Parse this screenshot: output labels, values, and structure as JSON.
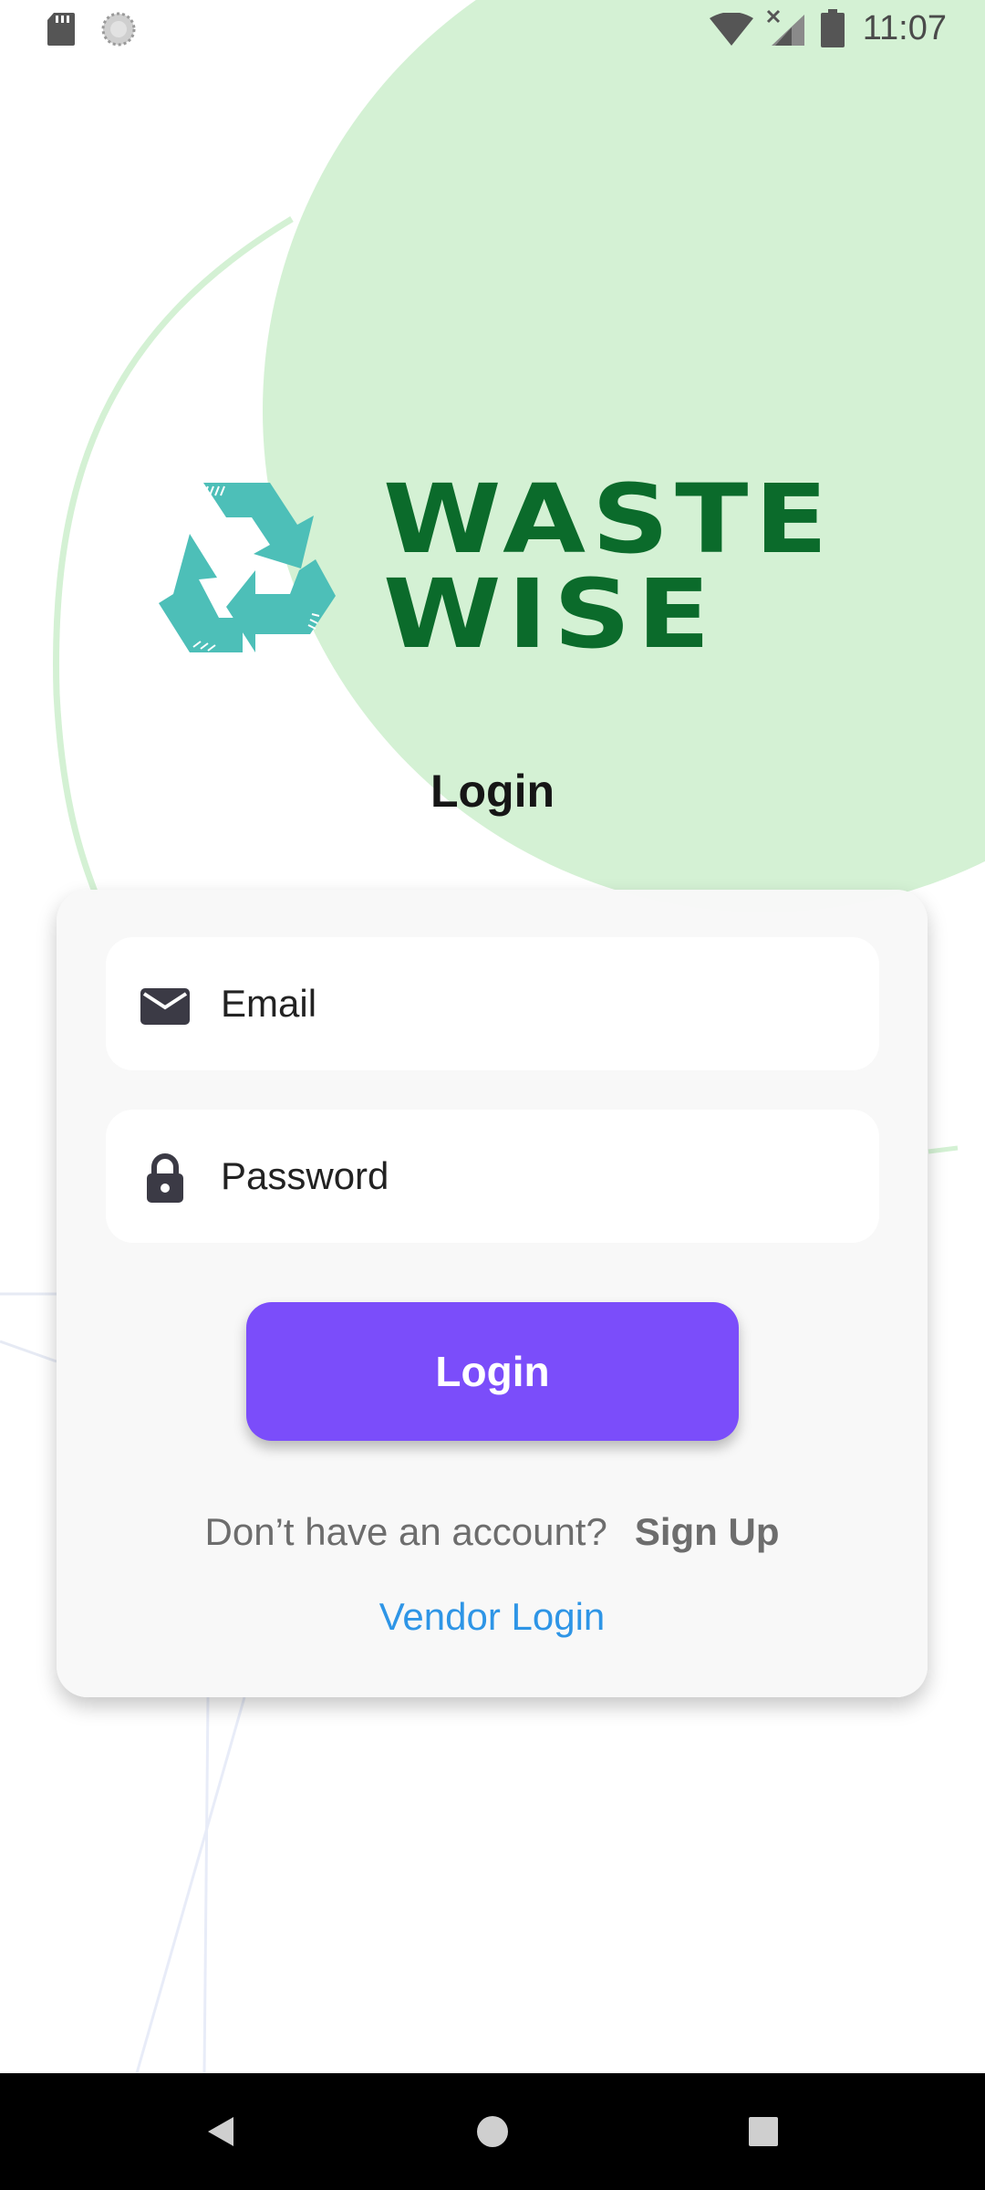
{
  "status_bar": {
    "time": "11:07",
    "left_icons": [
      "sd-card-icon",
      "sync-icon"
    ],
    "right_icons": [
      "wifi-icon",
      "signal-icon",
      "battery-icon"
    ]
  },
  "logo": {
    "line1": "WASTE",
    "line2": "WISE",
    "icon": "recycle-icon",
    "icon_color": "#4dbfb8",
    "text_color": "#0b6b2b"
  },
  "page_title": "Login",
  "form": {
    "email_placeholder": "Email",
    "email_icon": "mail-icon",
    "password_placeholder": "Password",
    "password_icon": "lock-icon",
    "login_button": "Login",
    "no_account_text": "Don’t have an account?",
    "signup_link": "Sign Up",
    "vendor_link": "Vendor Login"
  },
  "colors": {
    "accent": "#7b4dfa",
    "link": "#2e95e6",
    "background_circle": "#d4f1d4"
  },
  "nav_bar": {
    "buttons": [
      "back-icon",
      "home-icon",
      "recents-icon"
    ]
  }
}
